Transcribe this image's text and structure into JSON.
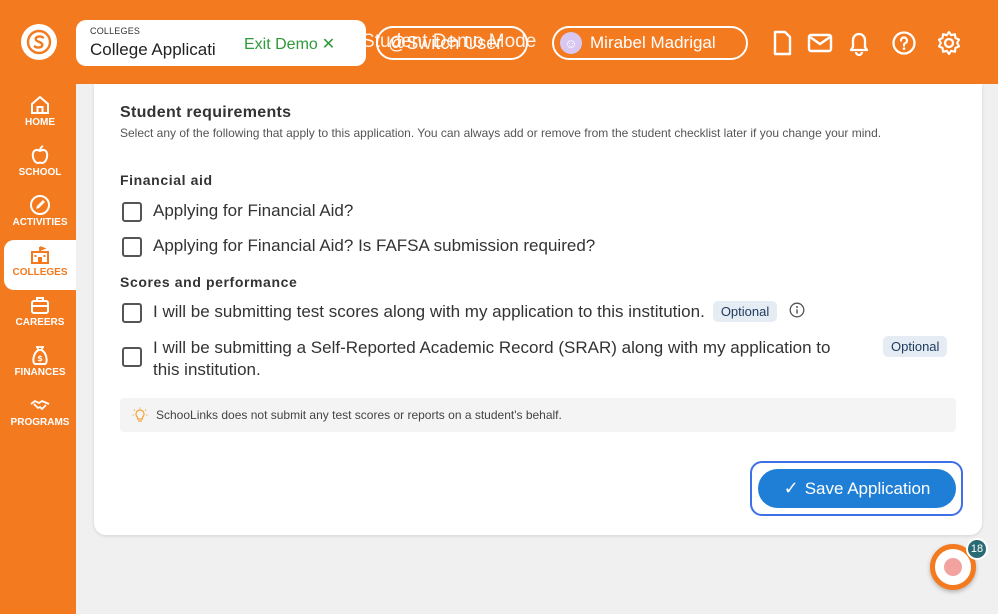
{
  "header": {
    "breadcrumb_small": "COLLEGES",
    "breadcrumb_title": "College Applicati",
    "exit_demo_label": "Exit Demo",
    "exit_demo_icon": "close-icon",
    "switch_label": "@Switch User",
    "mode_label": "Student Demo Mode",
    "user_name": "Mirabel Madrigal",
    "icons": [
      "document-icon",
      "mail-icon",
      "bell-icon",
      "help-icon",
      "gear-icon"
    ],
    "brand_color": "#f37a1f"
  },
  "sidebar": {
    "items": [
      {
        "label": "HOME",
        "icon": "home-icon",
        "active": false
      },
      {
        "label": "SCHOOL",
        "icon": "apple-icon",
        "active": false
      },
      {
        "label": "ACTIVITIES",
        "icon": "pencil-icon",
        "active": false
      },
      {
        "label": "COLLEGES",
        "icon": "college-icon",
        "active": true
      },
      {
        "label": "CAREERS",
        "icon": "briefcase-icon",
        "active": false
      },
      {
        "label": "FINANCES",
        "icon": "money-bag-icon",
        "active": false
      },
      {
        "label": "PROGRAMS",
        "icon": "handshake-icon",
        "active": false
      }
    ]
  },
  "main": {
    "title": "Student requirements",
    "description": "Select any of the following that apply to this application. You can always add or remove from the student checklist later if you change your mind.",
    "financial_aid": {
      "heading": "Financial aid",
      "options": [
        {
          "label": "Applying for Financial Aid?",
          "checked": false
        },
        {
          "label": "Applying for Financial Aid? Is FAFSA submission required?",
          "checked": false
        }
      ]
    },
    "scores": {
      "heading": "Scores and performance",
      "options": [
        {
          "label": "I will be submitting test scores along with my application to this institution.",
          "badge": "Optional",
          "checked": false
        },
        {
          "label_line1": "I will be submitting a Self-Reported Academic Record (SRAR) along with my application to",
          "label_line2": "this institution.",
          "badge": "Optional",
          "checked": false
        }
      ]
    },
    "notice": "SchooLinks does not submit any test scores or reports on a student's behalf.",
    "save_label": "Save Application"
  },
  "chat": {
    "badge_count": "18"
  }
}
